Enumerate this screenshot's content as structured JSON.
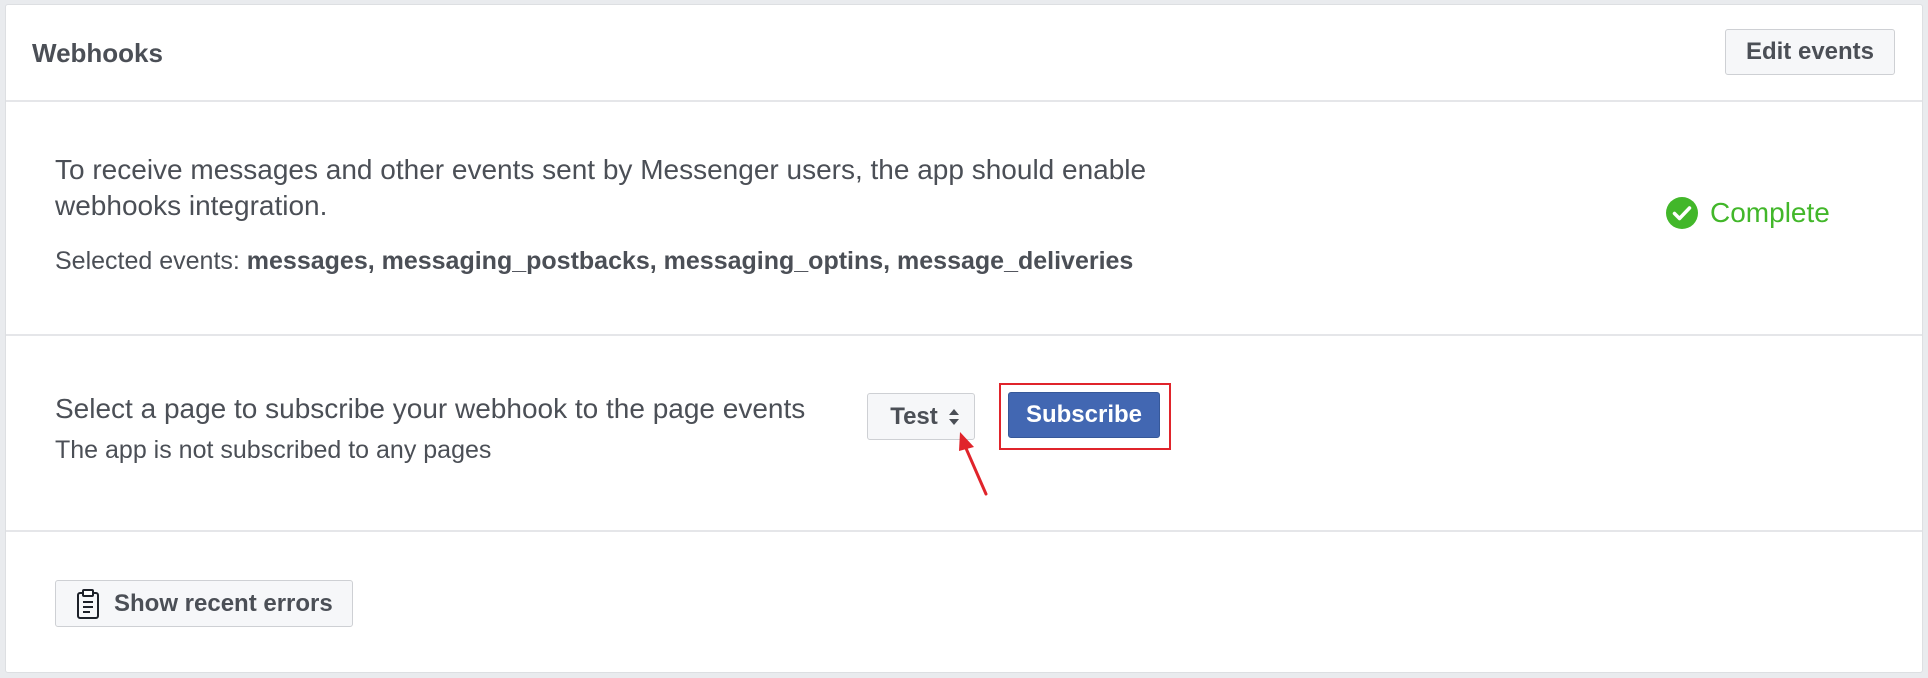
{
  "header": {
    "title": "Webhooks",
    "edit_events_label": "Edit events"
  },
  "integration": {
    "description": "To receive messages and other events sent by Messenger users, the app should enable webhooks integration.",
    "selected_label": "Selected events:",
    "selected_events": "messages, messaging_postbacks, messaging_optins, message_deliveries",
    "status_text": "Complete",
    "status_icon": "check-circle-icon",
    "status_color": "#42b72a"
  },
  "subscription": {
    "title": "Select a page to subscribe your webhook to the page events",
    "note": "The app is not subscribed to any pages",
    "page_select_value": "Test",
    "subscribe_label": "Subscribe",
    "subscribe_color": "#4267b2",
    "annotation_color": "#e0242b"
  },
  "errors": {
    "button_label": "Show recent errors",
    "icon": "clipboard-icon"
  }
}
